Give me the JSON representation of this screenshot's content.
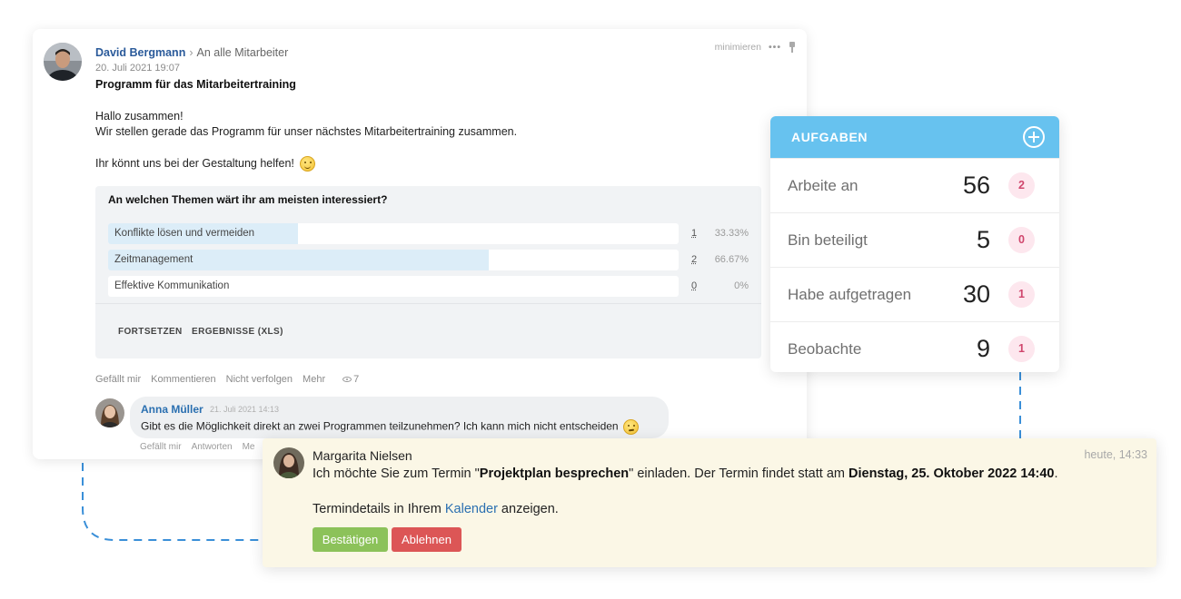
{
  "post": {
    "author": "David Bergmann",
    "recipient": "An alle Mitarbeiter",
    "date": "20. Juli 2021 19:07",
    "title": "Programm für das Mitarbeitertraining",
    "minimize_label": "minimieren",
    "more_dots": "•••",
    "greeting": "Hallo zusammen!",
    "line1": "Wir stellen gerade das Programm für unser nächstes Mitarbeitertraining zusammen.",
    "line2": "Ihr könnt uns bei der Gestaltung helfen!",
    "poll": {
      "question": "An welchen Themen wärt ihr am meisten interessiert?",
      "options": [
        {
          "label": "Konflikte lösen und vermeiden",
          "count": "1",
          "percent": "33.33%",
          "fill": 0.3333
        },
        {
          "label": "Zeitmanagement",
          "count": "2",
          "percent": "66.67%",
          "fill": 0.6667
        },
        {
          "label": "Effektive Kommunikation",
          "count": "0",
          "percent": "0%",
          "fill": 0
        }
      ],
      "continue_label": "FORTSETZEN",
      "results_label": "ERGEBNISSE (XLS)"
    },
    "footer": {
      "like": "Gefällt mir",
      "comment": "Kommentieren",
      "unfollow": "Nicht verfolgen",
      "more": "Mehr",
      "views": "7"
    },
    "comment": {
      "author": "Anna Müller",
      "date": "21. Juli 2021 14:13",
      "text": "Gibt es die Möglichkeit direkt an zwei Programmen teilzunehmen? Ich kann mich nicht entscheiden",
      "like": "Gefällt mir",
      "reply": "Antworten",
      "more": "Me"
    }
  },
  "tasks": {
    "title": "AUFGABEN",
    "rows": [
      {
        "label": "Arbeite an",
        "count": "56",
        "badge": "2"
      },
      {
        "label": "Bin beteiligt",
        "count": "5",
        "badge": "0"
      },
      {
        "label": "Habe aufgetragen",
        "count": "30",
        "badge": "1"
      },
      {
        "label": "Beobachte",
        "count": "9",
        "badge": "1"
      }
    ]
  },
  "notification": {
    "author": "Margarita Nielsen",
    "time": "heute, 14:33",
    "text_pre": "Ich möchte Sie zum Termin \"",
    "event_name": "Projektplan besprechen",
    "text_mid": "\" einladen. Der Termin findet statt am ",
    "event_date": "Dienstag, 25. Oktober  2022 14:40",
    "text_post": ".",
    "details_pre": "Termindetails in Ihrem ",
    "details_link": "Kalender",
    "details_post": " anzeigen.",
    "confirm_label": "Bestätigen",
    "decline_label": "Ablehnen"
  },
  "colors": {
    "accent_blue": "#67c2ef",
    "confirm_green": "#8cc25a",
    "decline_red": "#dc5656",
    "badge_pink": "#fde7ee"
  }
}
